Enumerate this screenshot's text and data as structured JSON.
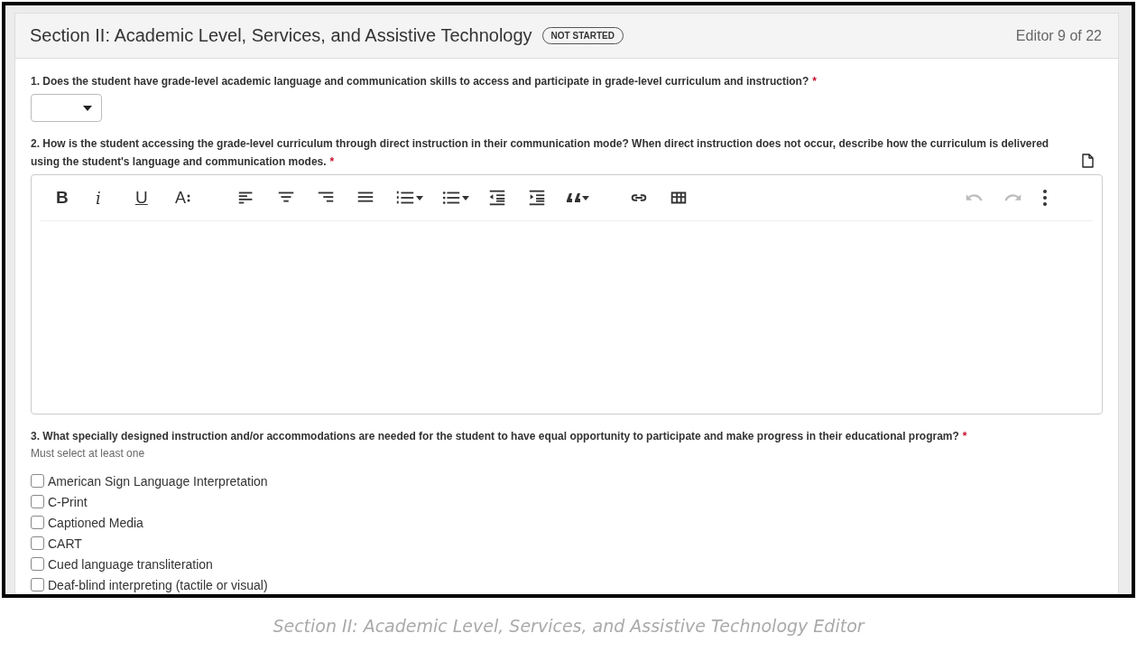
{
  "section": {
    "title": "Section II: Academic Level, Services, and Assistive Technology",
    "status": "NOT STARTED",
    "counter": "Editor 9 of 22"
  },
  "questions": [
    {
      "kind": "dropdown",
      "text": "1. Does the student have grade-level academic language and communication skills to access and participate in grade-level curriculum and instruction?",
      "required_mark": "*"
    },
    {
      "kind": "editor",
      "text": "2. How is the student accessing the grade-level curriculum through direct instruction in their communication mode? When direct instruction does not occur, describe how the curriculum is delivered using the student's language and communication modes.",
      "required_mark": "*",
      "note_icon": true,
      "toolbar_groups": [
        {
          "items": [
            {
              "kind": "bold",
              "label": "B"
            },
            {
              "kind": "italic",
              "label": "i"
            },
            {
              "kind": "underline",
              "label": "U"
            },
            {
              "kind": "font-size",
              "label": "A"
            }
          ]
        },
        {
          "items": [
            {
              "kind": "align-left"
            },
            {
              "kind": "align-center"
            },
            {
              "kind": "align-right"
            },
            {
              "kind": "justify"
            },
            {
              "kind": "ordered-list",
              "menu": true
            },
            {
              "kind": "bullet-list",
              "menu": true
            },
            {
              "kind": "outdent"
            },
            {
              "kind": "indent"
            },
            {
              "kind": "quote",
              "menu": true
            }
          ]
        },
        {
          "items": [
            {
              "kind": "link"
            },
            {
              "kind": "table"
            }
          ]
        },
        {
          "items": [
            {
              "kind": "undo",
              "disabled": true
            },
            {
              "kind": "redo",
              "disabled": true
            },
            {
              "kind": "more"
            }
          ]
        }
      ]
    },
    {
      "kind": "checklist",
      "text": "3. What specially designed instruction and/or accommodations are needed for the student to have equal opportunity to participate and make progress in their educational program?",
      "required_mark": "*",
      "hint": "Must select at least one",
      "options": [
        {
          "label": "American Sign Language Interpretation",
          "checked": false
        },
        {
          "label": "C-Print",
          "checked": false
        },
        {
          "label": "Captioned Media",
          "checked": false
        },
        {
          "label": "CART",
          "checked": false
        },
        {
          "label": "Cued language transliteration",
          "checked": false
        },
        {
          "label": "Deaf-blind interpreting (tactile or visual)",
          "checked": false
        }
      ]
    }
  ],
  "caption": "Section II: Academic Level, Services, and Assistive Technology Editor"
}
